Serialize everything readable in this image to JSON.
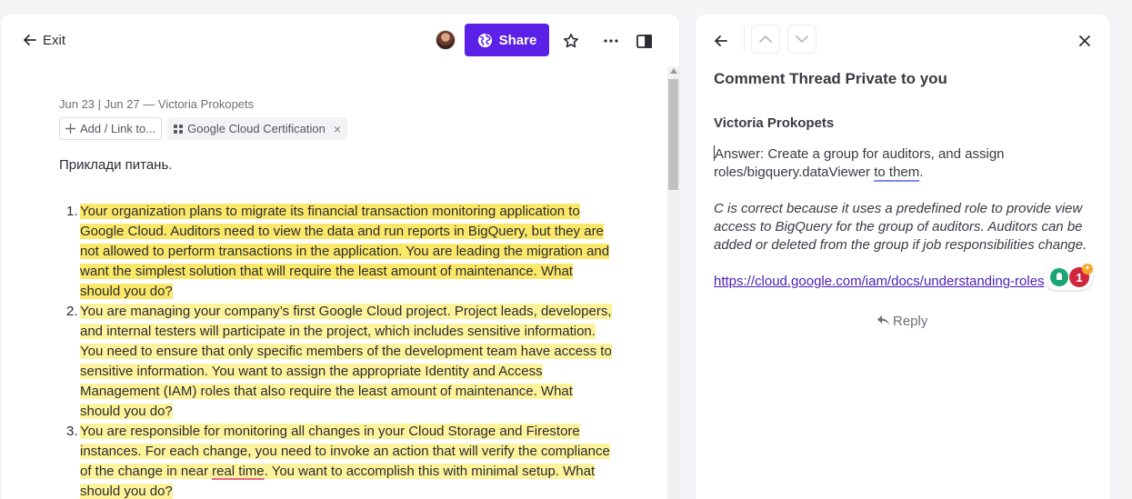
{
  "doc_header": {
    "exit_label": "Exit",
    "share_label": "Share"
  },
  "doc": {
    "meta": "Jun 23 | Jun 27 — Victoria Prokopets",
    "add_link_label": "Add / Link to...",
    "tag_label": "Google Cloud Certification",
    "intro": "Приклади питань.",
    "questions": [
      {
        "num": "1.",
        "text": "Your organization plans to migrate its financial transaction monitoring application to Google Cloud. Auditors need to view the data and run reports in BigQuery, but they are not allowed to perform transactions in the application. You are leading the migration and want the simplest solution that will require the least amount of maintenance. What should you do?"
      },
      {
        "num": "2.",
        "text": "You are managing your company’s first Google Cloud project. Project leads, developers, and internal testers will participate in the project, which includes sensitive information. You need to ensure that only specific members of the development team have access to sensitive information. You want to assign the appropriate Identity and Access Management (IAM) roles that also require the least amount of maintenance. What should you do?"
      },
      {
        "num": "3.",
        "text_before": "You are responsible for monitoring all changes in your Cloud Storage and Firestore instances. For each change, you need to invoke an action that will verify the compliance of the change in near ",
        "text_underlined": "real time",
        "text_after": ". You want to accomplish this with minimal setup. What should you do?"
      }
    ]
  },
  "comment_panel": {
    "title": "Comment Thread Private to you",
    "author": "Victoria Prokopets",
    "answer_main": "Answer: Create a group for auditors, and assign roles/bigquery.dataViewer ",
    "answer_underlined": "to them",
    "answer_end": ".",
    "explanation": "C is correct because it uses a predefined role to provide view access to BigQuery for the group of auditors. Auditors can be added or deleted from the group if job responsibilities change.",
    "link": "https://cloud.google.com/iam/docs/understanding-roles",
    "extension_count": "1",
    "extension_plus": "+",
    "reply_label": "Reply"
  }
}
